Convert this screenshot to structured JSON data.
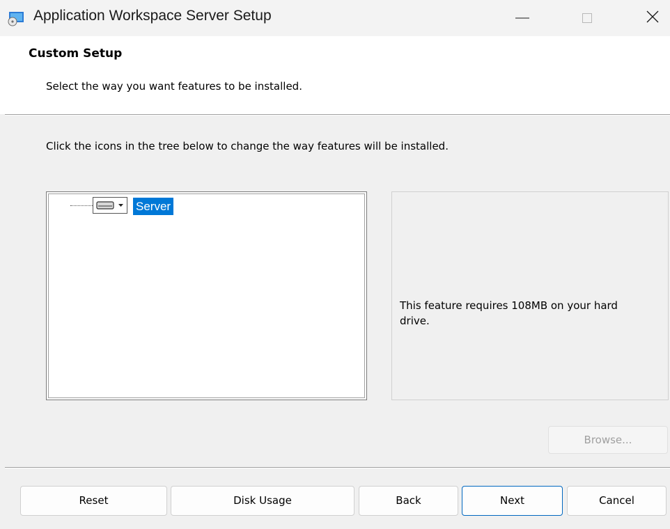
{
  "window": {
    "title": "Application Workspace Server Setup",
    "icon": "installer-app-icon",
    "controls": [
      "minimize-icon",
      "maximize-icon",
      "close-icon"
    ]
  },
  "header": {
    "title": "Custom Setup",
    "subtitle": "Select the way you want features to be installed."
  },
  "body": {
    "instructions": "Click the icons in the tree below to change the way features will be installed.",
    "tree": {
      "items": [
        {
          "label": "Server",
          "icon": "hard-drive-icon",
          "selected": true
        }
      ]
    },
    "description": "This feature requires 108MB on your hard drive.",
    "browse_label": "Browse..."
  },
  "footer": {
    "reset_label": "Reset",
    "disk_usage_label": "Disk Usage",
    "back_label": "Back",
    "next_label": "Next",
    "cancel_label": "Cancel"
  },
  "colors": {
    "selection": "#0078d7",
    "default_button_border": "#0067c0",
    "dialog_background": "#f0f0f0"
  }
}
